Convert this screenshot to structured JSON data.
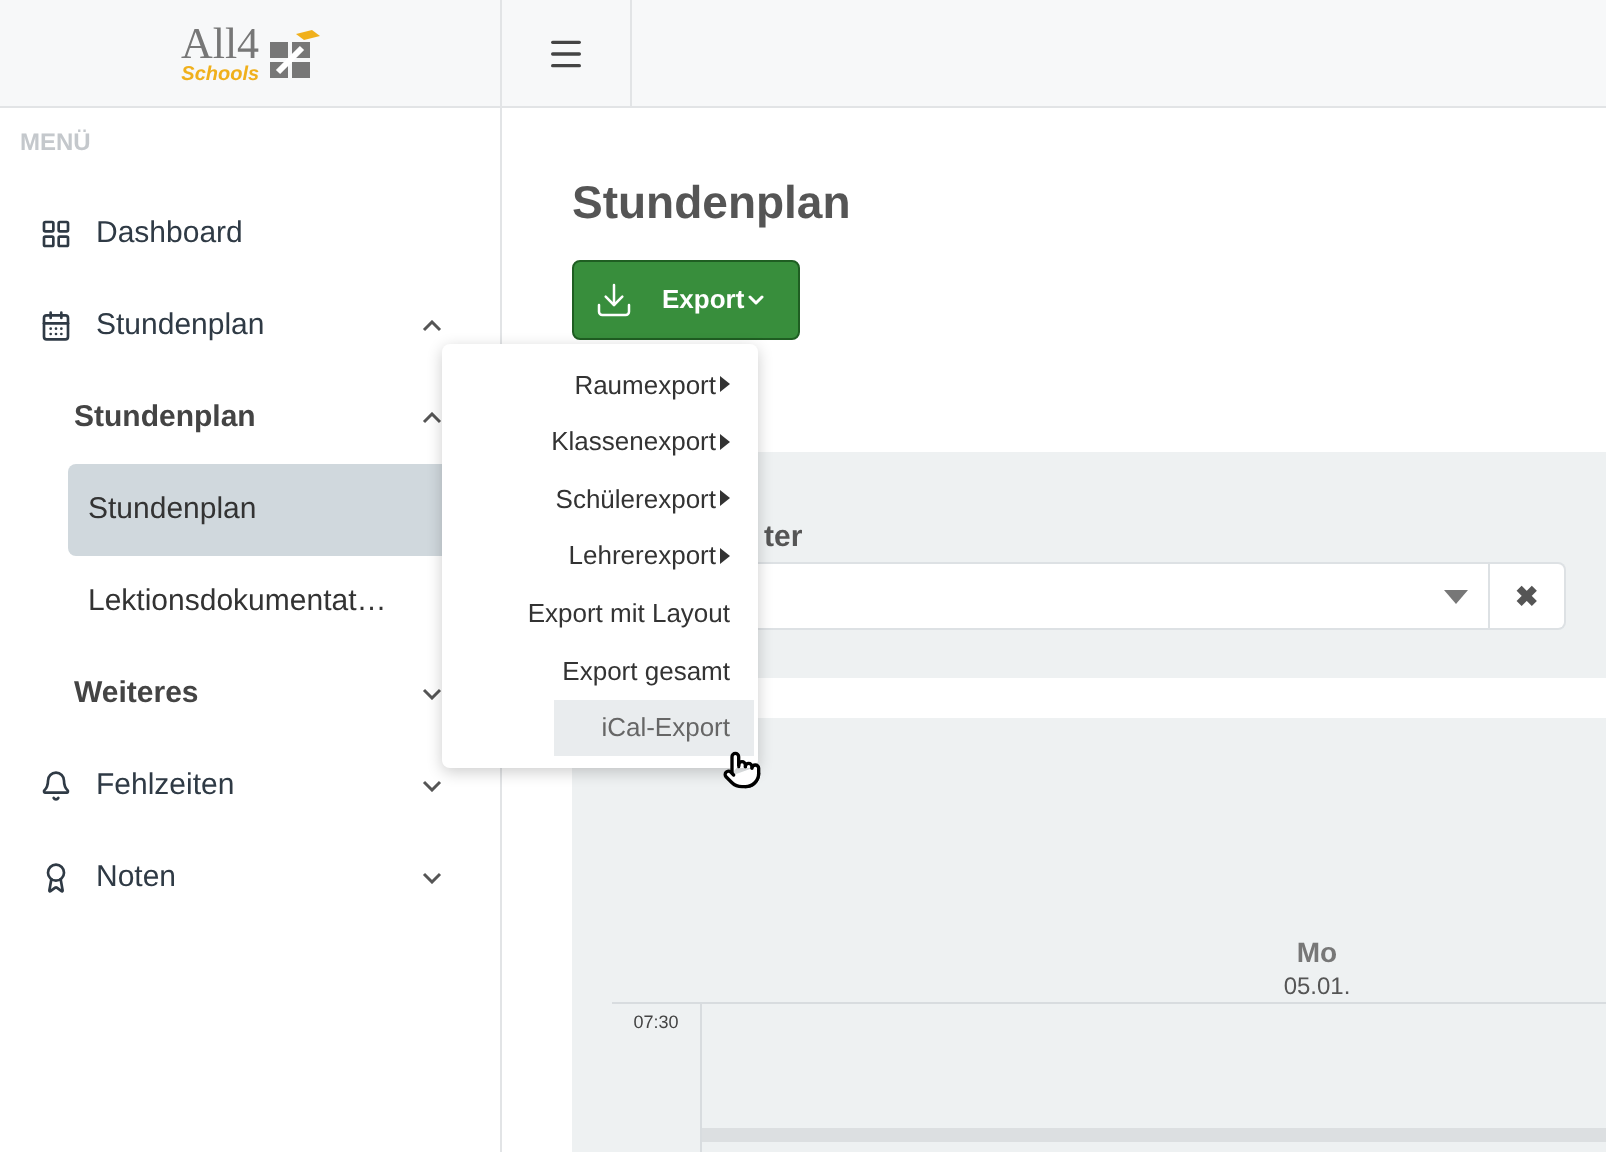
{
  "logo": {
    "main": "All4",
    "sub": "Schools"
  },
  "sidebar": {
    "heading": "MENÜ",
    "items": [
      {
        "label": "Dashboard",
        "kind": "link"
      },
      {
        "label": "Stundenplan",
        "kind": "menu",
        "expanded": true,
        "children": [
          {
            "label": "Stundenplan",
            "expanded": true,
            "children": [
              {
                "label": "Stundenplan",
                "selected": true
              },
              {
                "label": "Lektionsdokumentat…",
                "selected": false
              }
            ]
          },
          {
            "label": "Weiteres",
            "expanded": false
          }
        ]
      },
      {
        "label": "Fehlzeiten",
        "kind": "menu",
        "expanded": false
      },
      {
        "label": "Noten",
        "kind": "menu",
        "expanded": false
      }
    ]
  },
  "page": {
    "title": "Stundenplan",
    "export_button": "Export"
  },
  "export_menu": [
    {
      "label": "Raumexport",
      "submenu": true,
      "selected": false
    },
    {
      "label": "Klassenexport",
      "submenu": true,
      "selected": false
    },
    {
      "label": "Schülerexport",
      "submenu": true,
      "selected": false
    },
    {
      "label": "Lehrerexport",
      "submenu": true,
      "selected": false
    },
    {
      "label": "Export mit Layout",
      "submenu": false,
      "selected": false
    },
    {
      "label": "Export gesamt",
      "submenu": false,
      "selected": false
    },
    {
      "label": "iCal-Export",
      "submenu": false,
      "selected": true
    }
  ],
  "filter": {
    "label": "ter",
    "clear": "✖"
  },
  "calendar": {
    "day": "Mo",
    "date": "05.01.",
    "times": [
      "07:30"
    ]
  }
}
